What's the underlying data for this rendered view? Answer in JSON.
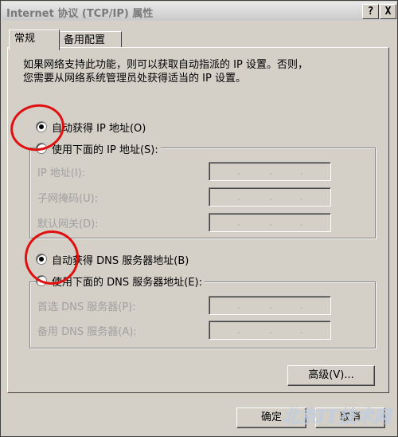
{
  "window": {
    "title": "Internet 协议 (TCP/IP) 属性",
    "help_button": "?",
    "close_button": "X"
  },
  "tabs": [
    {
      "label": "常规",
      "active": true
    },
    {
      "label": "备用配置",
      "active": false
    }
  ],
  "description": {
    "line1": "如果网络支持此功能，则可以获取自动指派的 IP 设置。否则，",
    "line2": "您需要从网络系统管理员处获得适当的 IP 设置。"
  },
  "ip_section": {
    "auto_label": "自动获得 IP 地址(O)",
    "auto_selected": true,
    "manual_label": "使用下面的 IP 地址(S):",
    "manual_selected": false,
    "fields": [
      {
        "label": "IP 地址(I):",
        "value": ""
      },
      {
        "label": "子网掩码(U):",
        "value": ""
      },
      {
        "label": "默认网关(D):",
        "value": ""
      }
    ]
  },
  "dns_section": {
    "auto_label": "自动获得 DNS 服务器地址(B)",
    "auto_selected": true,
    "manual_label": "使用下面的 DNS 服务器地址(E):",
    "manual_selected": false,
    "fields": [
      {
        "label": "首选 DNS 服务器(P):",
        "value": ""
      },
      {
        "label": "备用 DNS 服务器(A):",
        "value": ""
      }
    ]
  },
  "buttons": {
    "advanced": "高级(V)...",
    "ok": "确定",
    "cancel": "取消"
  },
  "watermark": "北京IT技术网",
  "annotation_color": "#e01010"
}
